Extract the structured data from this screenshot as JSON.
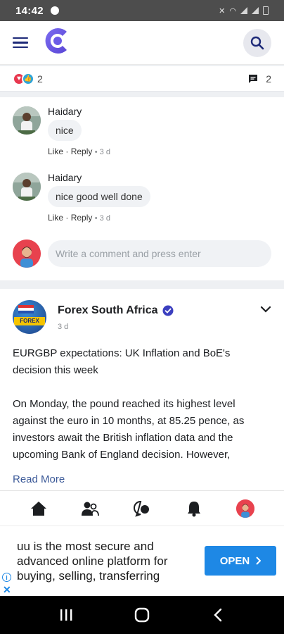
{
  "status_bar": {
    "time": "14:42"
  },
  "reactions": {
    "reaction_count": "2",
    "comment_count": "2"
  },
  "comments": [
    {
      "author": "Haidary",
      "text": "nice",
      "like": "Like",
      "reply": "Reply",
      "time": "3 d"
    },
    {
      "author": "Haidary",
      "text": "nice good well done",
      "like": "Like",
      "reply": "Reply",
      "time": "3 d"
    }
  ],
  "comment_input": {
    "placeholder": "Write a comment and press enter"
  },
  "post": {
    "page_name": "Forex South Africa",
    "time": "3 d",
    "title": "EURGBP expectations: UK Inflation and BoE's decision this week",
    "body": "On Monday, the pound reached its highest level against the euro in 10 months, at 85.25 pence, as investors await the British inflation data and the upcoming Bank of England decision. However,",
    "read_more": "Read More"
  },
  "ad": {
    "text": "uu is the most secure and advanced online platform for buying, selling, transferring",
    "cta": "OPEN"
  },
  "colors": {
    "brand": "#6c5ce7",
    "nav_icon": "#1e2a78",
    "ad_button": "#1e88e5",
    "verified": "#3b3fbf"
  },
  "icons": [
    "menu-icon",
    "logo-icon",
    "search-icon",
    "heart-icon",
    "like-icon",
    "comment-icon",
    "verified-icon",
    "chevron-down-icon",
    "home-icon",
    "friends-icon",
    "chat-icon",
    "bell-icon",
    "profile-icon",
    "info-icon",
    "close-icon",
    "recents-icon",
    "home-button-icon",
    "back-icon"
  ]
}
